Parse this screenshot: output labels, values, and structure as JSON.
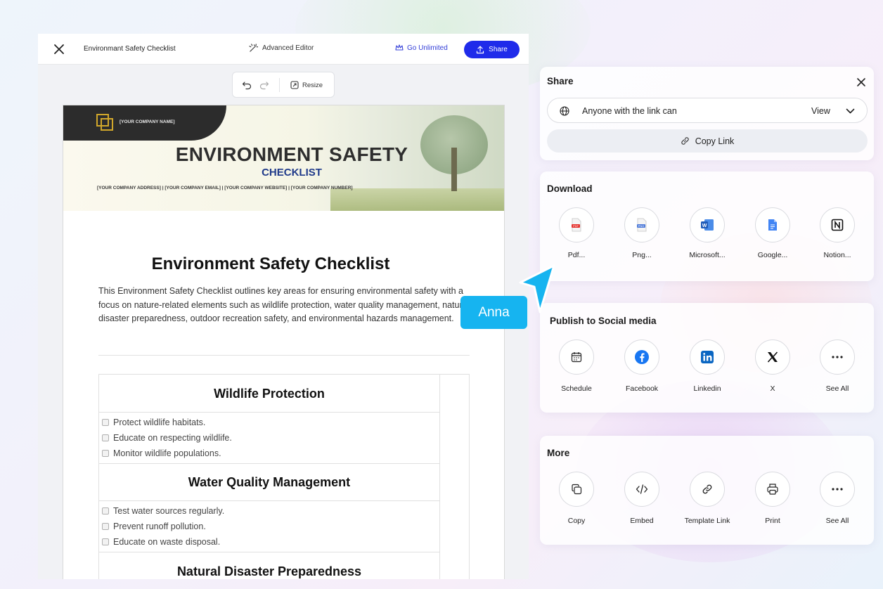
{
  "editor": {
    "doc_title": "Environmant Safety Checklist",
    "advanced_editor": "Advanced Editor",
    "go_unlimited": "Go Unlimited",
    "share": "Share",
    "resize": "Resize"
  },
  "document": {
    "company_name": "[YOUR COMPANY NAME]",
    "banner_title": "ENVIRONMENT SAFETY",
    "banner_subtitle": "CHECKLIST",
    "banner_contacts": "[YOUR COMPANY ADDRESS]  |  [YOUR COMPANY EMAIL]  |  [YOUR COMPANY WEBSITE]  |  [YOUR COMPANY NUMBER]",
    "title": "Environment Safety Checklist",
    "intro": "This Environment Safety Checklist outlines key areas for ensuring environmental safety with a focus on nature-related elements such as wildlife protection, water quality management, natural disaster preparedness, outdoor recreation safety, and environmental hazards management.",
    "sections": [
      {
        "heading": "Wildlife Protection",
        "items": [
          "Protect wildlife habitats.",
          "Educate on respecting wildlife.",
          "Monitor wildlife populations."
        ]
      },
      {
        "heading": "Water Quality Management",
        "items": [
          "Test water sources regularly.",
          "Prevent runoff pollution.",
          "Educate on waste disposal."
        ]
      },
      {
        "heading": "Natural Disaster Preparedness",
        "items": []
      }
    ]
  },
  "share_panel": {
    "title": "Share",
    "access_text": "Anyone with the link can",
    "access_level": "View",
    "copy_link": "Copy Link"
  },
  "download_panel": {
    "title": "Download",
    "options": [
      "Pdf...",
      "Png...",
      "Microsoft...",
      "Google...",
      "Notion..."
    ]
  },
  "social_panel": {
    "title": "Publish to Social media",
    "options": [
      "Schedule",
      "Facebook",
      "Linkedin",
      "X",
      "See All"
    ]
  },
  "more_panel": {
    "title": "More",
    "options": [
      "Copy",
      "Embed",
      "Template Link",
      "Print",
      "See All"
    ]
  },
  "cursor": {
    "user": "Anna",
    "color": "#16b4f0"
  },
  "colors": {
    "primary": "#1f2bea",
    "accent_gold": "#d1a72b",
    "doc_subtitle_blue": "#1f3a8a"
  }
}
